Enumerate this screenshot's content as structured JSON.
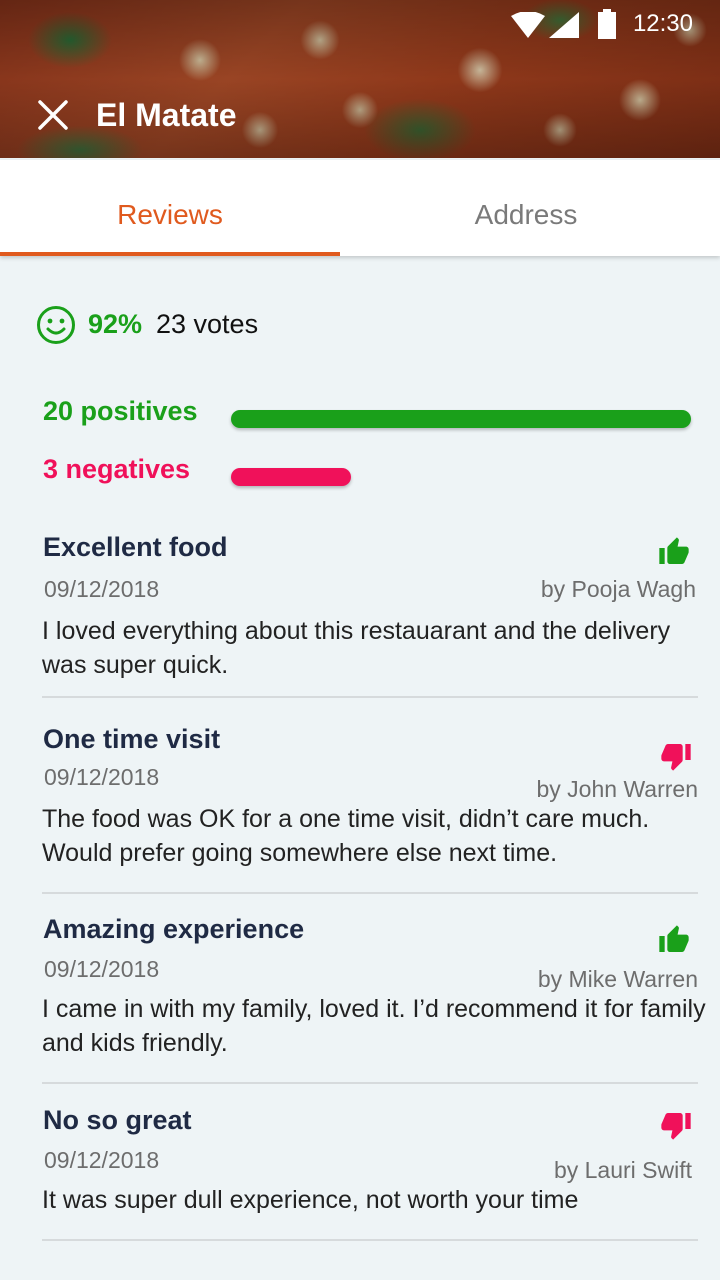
{
  "status_bar": {
    "time": "12:30"
  },
  "appbar": {
    "title": "El Matate"
  },
  "tabs": [
    {
      "label": "Reviews",
      "active": true
    },
    {
      "label": "Address",
      "active": false
    }
  ],
  "summary": {
    "percent": "92%",
    "votes": "23 votes",
    "positives_label": "20 positives",
    "negatives_label": "3 negatives",
    "positive_count": 20,
    "negative_count": 3,
    "positive_color": "#1aa01a",
    "negative_color": "#f0115a"
  },
  "reviews": [
    {
      "title": "Excellent food",
      "date": "09/12/2018",
      "author": "by Pooja Wagh",
      "body": "I loved everything about this restauarant and the delivery was super quick.",
      "sentiment": "thumbs-up"
    },
    {
      "title": "One time visit",
      "date": "09/12/2018",
      "author": "by John Warren",
      "body": "The food was OK for a one time visit, didn’t care much. Would prefer going somewhere else next time.",
      "sentiment": "thumbs-down"
    },
    {
      "title": "Amazing experience",
      "date": "09/12/2018",
      "author": "by Mike Warren",
      "body": "I came in with my family, loved it. I’d recommend it for family and kids friendly.",
      "sentiment": "thumbs-up"
    },
    {
      "title": "No so great",
      "date": "09/12/2018",
      "author": "by Lauri Swift",
      "body": "It was super dull experience, not worth your time",
      "sentiment": "thumbs-down"
    }
  ],
  "colors": {
    "accent": "#e05a1e",
    "positive": "#1aa01a",
    "negative": "#f0115a"
  }
}
